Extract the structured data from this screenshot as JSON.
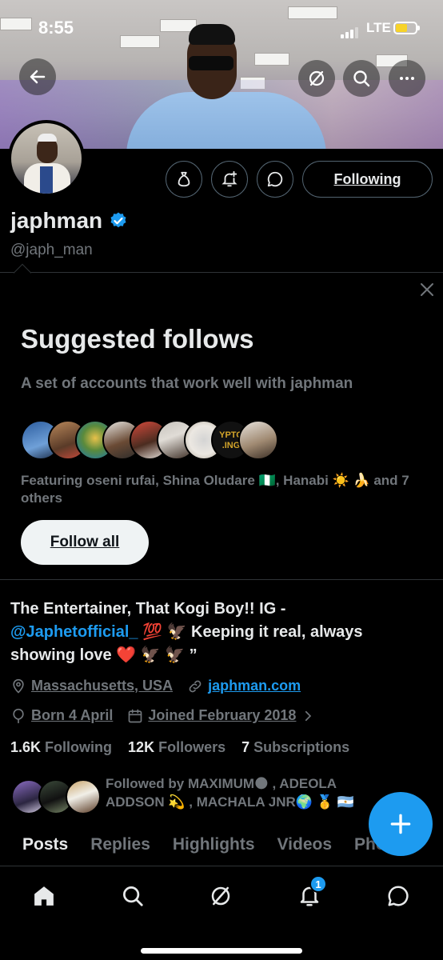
{
  "status_bar": {
    "time": "8:55",
    "network": "LTE",
    "battery_level": 0.55
  },
  "header": {
    "back_icon": "arrow-left-icon",
    "grok_icon": "grok-icon",
    "search_icon": "search-icon",
    "more_icon": "more-horizontal-icon"
  },
  "profile": {
    "display_name": "japhman",
    "handle": "@japh_man",
    "following_button": "Following",
    "actions": [
      "money-bag-icon",
      "bell-plus-icon",
      "message-icon"
    ]
  },
  "suggested": {
    "title": "Suggested follows",
    "subtitle": "A set of accounts that work well with japhman",
    "featuring": "Featuring oseni rufai, Shina Oludare 🇳🇬, Hanabi ☀️ 🍌 and 7 others",
    "follow_all": "Follow all",
    "crypto_avatar_text": "YPTO\n.ING"
  },
  "bio": {
    "line1": "The Entertainer, That Kogi Boy!! IG -",
    "mention": "@Japhetofficial_",
    "line2": " 💯 🦅 Keeping it real, always showing love ❤️ 🦅 🦅 ”",
    "location": "Massachusetts, USA",
    "website": "japhman.com",
    "born": "Born 4 April",
    "joined": "Joined February 2018"
  },
  "stats": {
    "following_count": "1.6K",
    "following_label": "Following",
    "followers_count": "12K",
    "followers_label": "Followers",
    "subscriptions_count": "7",
    "subscriptions_label": "Subscriptions"
  },
  "followed_by": "Followed by MAXIMUM🌑 , ADEOLA ADDSON 💫 , MACHALA JNR🌍 🥇 🇦🇷",
  "tabs": [
    "Posts",
    "Replies",
    "Highlights",
    "Videos",
    "Photos"
  ],
  "bottom_nav": {
    "items": [
      "home-icon",
      "search-icon",
      "grok-icon",
      "notifications-icon",
      "messages-icon"
    ],
    "notification_badge": "1"
  },
  "colors": {
    "accent": "#1d9bf0",
    "background": "#000000",
    "muted": "#71767b"
  }
}
